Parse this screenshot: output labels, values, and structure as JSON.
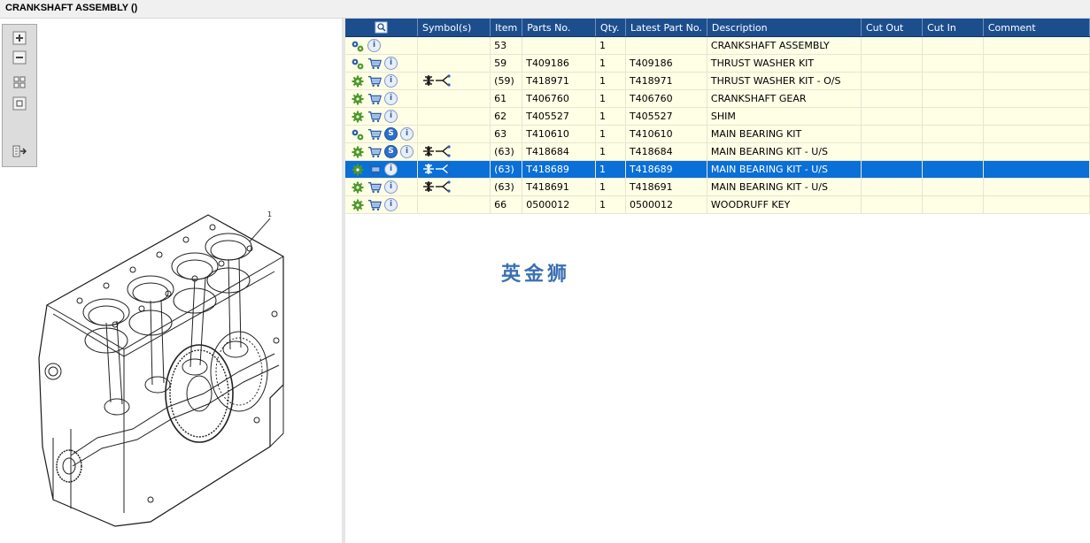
{
  "window": {
    "title": "CRANKSHAFT ASSEMBLY ()"
  },
  "toolbar": {
    "buttons": [
      {
        "name": "zoom-in",
        "icon": "plus-icon"
      },
      {
        "name": "zoom-out",
        "icon": "minus-icon"
      },
      {
        "name": "fit-all",
        "icon": "grid-icon"
      },
      {
        "name": "fit-window",
        "icon": "square-icon"
      },
      {
        "name": "export",
        "icon": "export-icon"
      }
    ]
  },
  "drawing": {
    "callout": "1"
  },
  "table": {
    "headers": [
      "Symbol(s)",
      "Item",
      "Parts No.",
      "Qty.",
      "Latest Part No.",
      "Description",
      "Cut Out",
      "Cut In",
      "Comment"
    ],
    "rows": [
      {
        "icons": [
          "gears",
          "info"
        ],
        "symbol": "",
        "item": "53",
        "parts_no": "",
        "qty": "1",
        "latest": "",
        "desc": "CRANKSHAFT ASSEMBLY",
        "cut_out": "",
        "cut_in": "",
        "comment": ""
      },
      {
        "icons": [
          "gears",
          "cart",
          "info"
        ],
        "symbol": "",
        "item": "59",
        "parts_no": "T409186",
        "qty": "1",
        "latest": "T409186",
        "desc": "THRUST WASHER KIT",
        "cut_out": "",
        "cut_in": "",
        "comment": ""
      },
      {
        "icons": [
          "gear",
          "cart",
          "info"
        ],
        "symbol": "split",
        "item": "(59)",
        "parts_no": "T418971",
        "qty": "1",
        "latest": "T418971",
        "desc": "THRUST WASHER KIT - O/S",
        "cut_out": "",
        "cut_in": "",
        "comment": ""
      },
      {
        "icons": [
          "gear",
          "cart",
          "info"
        ],
        "symbol": "",
        "item": "61",
        "parts_no": "T406760",
        "qty": "1",
        "latest": "T406760",
        "desc": "CRANKSHAFT GEAR",
        "cut_out": "",
        "cut_in": "",
        "comment": ""
      },
      {
        "icons": [
          "gear",
          "cart",
          "info"
        ],
        "symbol": "",
        "item": "62",
        "parts_no": "T405527",
        "qty": "1",
        "latest": "T405527",
        "desc": "SHIM",
        "cut_out": "",
        "cut_in": "",
        "comment": ""
      },
      {
        "icons": [
          "gears",
          "cart",
          "s",
          "info"
        ],
        "symbol": "",
        "item": "63",
        "parts_no": "T410610",
        "qty": "1",
        "latest": "T410610",
        "desc": "MAIN BEARING KIT",
        "cut_out": "",
        "cut_in": "",
        "comment": ""
      },
      {
        "icons": [
          "gear",
          "cart",
          "s",
          "info"
        ],
        "symbol": "split",
        "item": "(63)",
        "parts_no": "T418684",
        "qty": "1",
        "latest": "T418684",
        "desc": "MAIN BEARING KIT - U/S",
        "cut_out": "",
        "cut_in": "",
        "comment": ""
      },
      {
        "icons": [
          "gear",
          "cart",
          "info"
        ],
        "symbol": "split",
        "item": "(63)",
        "parts_no": "T418689",
        "qty": "1",
        "latest": "T418689",
        "desc": "MAIN BEARING KIT - U/S",
        "cut_out": "",
        "cut_in": "",
        "comment": "",
        "selected": true
      },
      {
        "icons": [
          "gear",
          "cart",
          "info"
        ],
        "symbol": "split",
        "item": "(63)",
        "parts_no": "T418691",
        "qty": "1",
        "latest": "T418691",
        "desc": "MAIN BEARING KIT - U/S",
        "cut_out": "",
        "cut_in": "",
        "comment": ""
      },
      {
        "icons": [
          "gear",
          "cart",
          "info"
        ],
        "symbol": "",
        "item": "66",
        "parts_no": "0500012",
        "qty": "1",
        "latest": "0500012",
        "desc": "WOODRUFF KEY",
        "cut_out": "",
        "cut_in": "",
        "comment": ""
      }
    ]
  },
  "watermark": "英金狮",
  "colors": {
    "header": "#1c4e8e",
    "row": "#ffffe6",
    "selected": "#0a6fd6",
    "gear": "#4d9a2a",
    "cart": "#2e5fa8"
  }
}
